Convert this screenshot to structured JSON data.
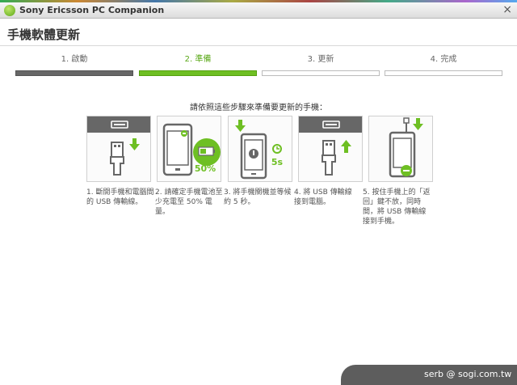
{
  "window": {
    "title": "Sony Ericsson PC Companion",
    "close_label": "×"
  },
  "page": {
    "title": "手機軟體更新"
  },
  "steps": [
    {
      "label": "1. 啟動",
      "state": "done"
    },
    {
      "label": "2. 準備",
      "state": "active"
    },
    {
      "label": "3. 更新",
      "state": "pending"
    },
    {
      "label": "4. 完成",
      "state": "pending"
    }
  ],
  "instruction": "請依照這些步驟來準備要更新的手機：",
  "cards": [
    {
      "icon": "usb-unplug-icon",
      "text": "1. 斷開手機和電腦間的 USB 傳輸線。"
    },
    {
      "icon": "battery-phone-icon",
      "badge": "50%",
      "text": "2. 請確定手機電池至少充電至 50% 電量。"
    },
    {
      "icon": "power-off-phone-icon",
      "badge": "5s",
      "text": "3. 將手機關機並等候約 5 秒。"
    },
    {
      "icon": "usb-plug-icon",
      "text": "4. 將 USB 傳輸線接到電腦。"
    },
    {
      "icon": "back-key-phone-icon",
      "text": "5. 按住手機上的「返回」鍵不放，同時間，將 USB 傳輸線接到手機。"
    }
  ],
  "watermark": "serb @ sogi.com.tw",
  "colors": {
    "accent": "#6ebf23",
    "step_done": "#676767",
    "icon_dark": "#676767"
  }
}
